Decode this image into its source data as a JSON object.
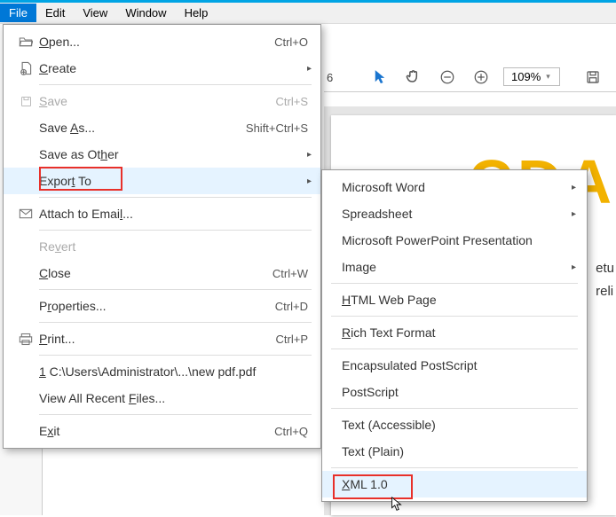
{
  "menuBar": {
    "file": "File",
    "edit": "Edit",
    "view": "View",
    "window": "Window",
    "help": "Help"
  },
  "toolbar": {
    "pageNo": "6",
    "zoom": "109%"
  },
  "fileMenu": {
    "open": {
      "label": "Open...",
      "shortcut": "Ctrl+O"
    },
    "create": {
      "label": "Create"
    },
    "save": {
      "label": "Save",
      "shortcut": "Ctrl+S"
    },
    "saveAs": {
      "label": "Save As...",
      "shortcut": "Shift+Ctrl+S"
    },
    "saveOther": {
      "label": "Save as Other"
    },
    "exportTo": {
      "label": "Export To"
    },
    "attach": {
      "label": "Attach to Email..."
    },
    "revert": {
      "label": "Revert"
    },
    "close": {
      "label": "Close",
      "shortcut": "Ctrl+W"
    },
    "properties": {
      "label": "Properties...",
      "shortcut": "Ctrl+D"
    },
    "print": {
      "label": "Print...",
      "shortcut": "Ctrl+P"
    },
    "recent": {
      "label": "1 C:\\Users\\Administrator\\...\\new pdf.pdf"
    },
    "allRecent": {
      "label": "View All Recent Files..."
    },
    "exit": {
      "label": "Exit",
      "shortcut": "Ctrl+Q"
    }
  },
  "exportMenu": {
    "word": "Microsoft Word",
    "spreadsheet": "Spreadsheet",
    "powerpoint": "Microsoft PowerPoint Presentation",
    "image": "Image",
    "html": "HTML Web Page",
    "rtf": "Rich Text Format",
    "eps": "Encapsulated PostScript",
    "ps": "PostScript",
    "textAcc": "Text (Accessible)",
    "textPlain": "Text (Plain)",
    "xml": "XML 1.0"
  },
  "doc": {
    "headline": "CDA",
    "line1": "etu",
    "line2": "reli"
  }
}
